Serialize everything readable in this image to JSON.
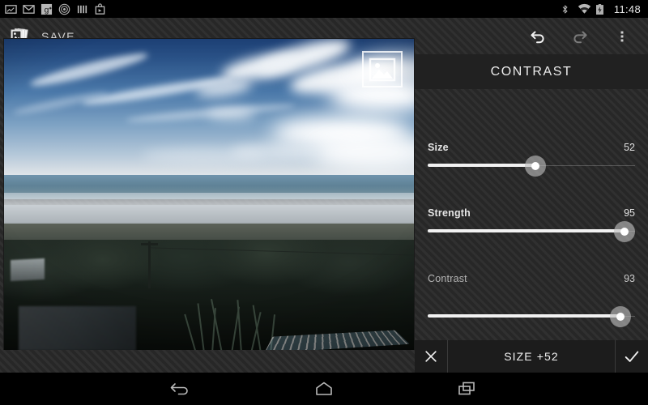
{
  "statusbar": {
    "left_icons": [
      {
        "name": "screenshot-icon",
        "label": "screenshot"
      },
      {
        "name": "gmail-icon",
        "label": "gmail"
      },
      {
        "name": "google-plus-icon",
        "label": "google-plus"
      },
      {
        "name": "target-icon",
        "label": "target"
      },
      {
        "name": "bars-icon",
        "label": "bars"
      },
      {
        "name": "store-bag-icon",
        "label": "store"
      }
    ],
    "right_icons": [
      {
        "name": "bluetooth-icon",
        "label": "bluetooth"
      },
      {
        "name": "wifi-icon",
        "label": "wifi"
      },
      {
        "name": "battery-charging-icon",
        "label": "battery charging"
      }
    ],
    "clock": "11:48"
  },
  "actionbar": {
    "app_icon": "gallery-photos-icon",
    "save_label": "SAVE",
    "undo_label": "Undo",
    "redo_label": "Redo",
    "overflow_label": "More options"
  },
  "photo": {
    "overlay_icon": "image-frame-icon",
    "alt": "Coastal landscape with blue sky, cirrus clouds, ocean, beach and dark trees"
  },
  "panel": {
    "title": "CONTRAST",
    "sliders": [
      {
        "name": "size",
        "label": "Size",
        "value": 52,
        "percent": 52,
        "dim": false
      },
      {
        "name": "strength",
        "label": "Strength",
        "value": 95,
        "percent": 95,
        "dim": false
      },
      {
        "name": "contrast",
        "label": "Contrast",
        "value": 93,
        "percent": 93,
        "dim": true
      }
    ]
  },
  "bottombar": {
    "cancel_label": "Cancel",
    "state_label": "SIZE +52",
    "apply_label": "Apply"
  },
  "navbar": {
    "back_label": "Back",
    "home_label": "Home",
    "recents_label": "Recent apps"
  },
  "colors": {
    "panel_title_bg": "#212121",
    "panel_bg": "#2b2b2b",
    "bottom_bar_bg": "#1c1c1c",
    "track_active": "#f2f2f2",
    "knob": "rgba(190,190,190,0.62)",
    "text_primary": "#ececec",
    "text_dim": "#b4b4b4"
  }
}
